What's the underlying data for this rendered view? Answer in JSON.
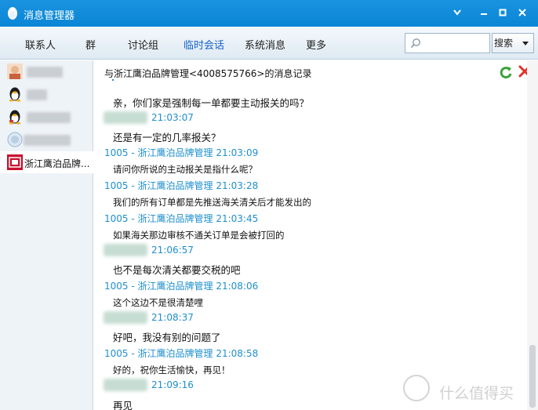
{
  "window": {
    "title": "消息管理器"
  },
  "toolbar": {
    "tabs": [
      {
        "label": "联系人"
      },
      {
        "label": "群"
      },
      {
        "label": "讨论组"
      },
      {
        "label": "临时会话"
      },
      {
        "label": "系统消息"
      },
      {
        "label": "更多"
      }
    ],
    "active_tab": "临时会话",
    "search_placeholder": "",
    "search_button": "搜索"
  },
  "sidebar": {
    "contacts": [
      {
        "label": "",
        "icon": "avatar-photo"
      },
      {
        "label": "",
        "icon": "qq-penguin-icon"
      },
      {
        "label": "",
        "icon": "qq-penguin-icon"
      },
      {
        "label": "",
        "icon": "round-avatar"
      },
      {
        "label": "浙江鹰泊品牌...",
        "icon": "brand-logo"
      }
    ]
  },
  "main": {
    "record_title": "与浙江鹰泊品牌管理<4008575766>的消息记录",
    "messages": [
      {
        "text": "亲，你们家是强制每一单都要主动报关的吗？"
      },
      {
        "sender": "",
        "time": "21:03:07"
      },
      {
        "text": "还是有一定的几率报关？"
      },
      {
        "sender": "1005 - 浙江鹰泊品牌管理",
        "time": "21:03:09"
      },
      {
        "text": "请问你所说的主动报关是指什么呢？"
      },
      {
        "sender": "1005 - 浙江鹰泊品牌管理",
        "time": "21:03:28"
      },
      {
        "text": "我们的所有订单都是先推送海关清关后才能发出的"
      },
      {
        "sender": "1005 - 浙江鹰泊品牌管理",
        "time": "21:03:45"
      },
      {
        "text": "如果海关那边审核不通关订单是会被打回的"
      },
      {
        "sender": "",
        "time": "21:06:57"
      },
      {
        "text": "也不是每次清关都要交税的吧"
      },
      {
        "sender": "1005 - 浙江鹰泊品牌管理",
        "time": "21:08:06"
      },
      {
        "text": "这个这边不是很清楚哩"
      },
      {
        "sender": "",
        "time": "21:08:37"
      },
      {
        "text": "好吧，我没有别的问题了"
      },
      {
        "sender": "1005 - 浙江鹰泊品牌管理",
        "time": "21:08:58"
      },
      {
        "text": "好的，祝你生活愉快，再见！"
      },
      {
        "sender": "",
        "time": "21:09:16"
      },
      {
        "text": "再见"
      }
    ]
  },
  "watermark": {
    "text": "什么值得买"
  },
  "colors": {
    "titlebar": "#0a86d6",
    "link": "#1e8fcf",
    "active_tab": "#1763c9",
    "close_x": "#e0312a",
    "refresh": "#3aa23a"
  }
}
